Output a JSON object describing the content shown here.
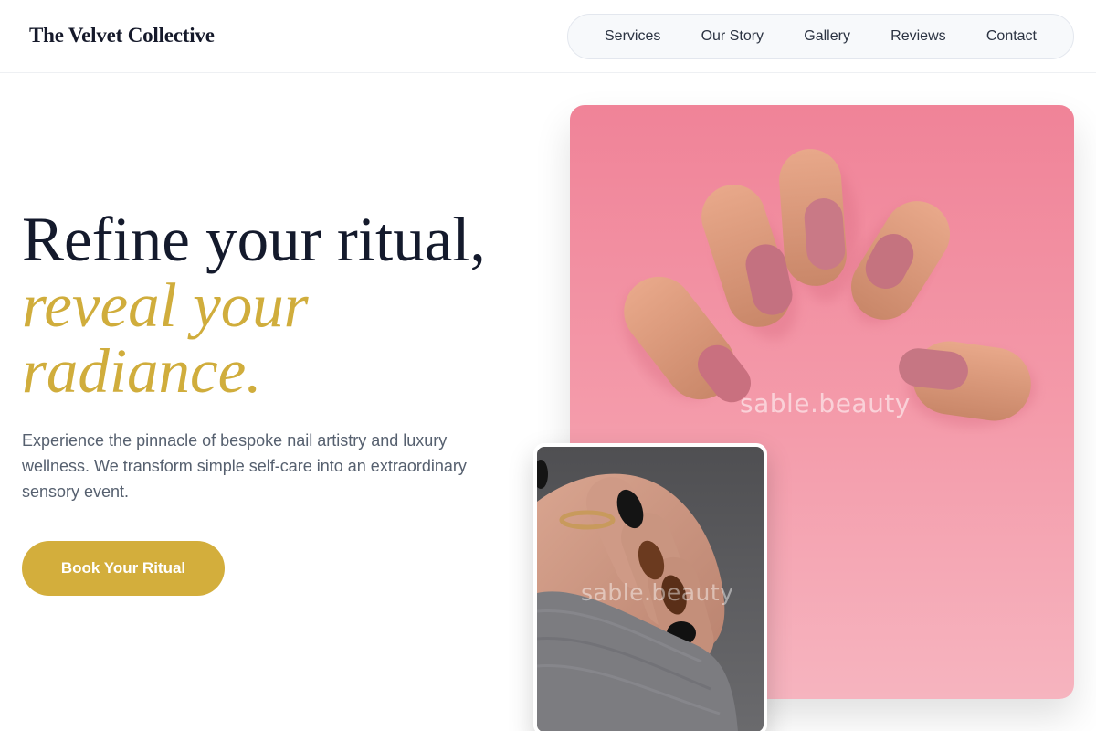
{
  "brand": {
    "name": "The Velvet Collective"
  },
  "nav": {
    "items": [
      {
        "label": "Services"
      },
      {
        "label": "Our Story"
      },
      {
        "label": "Gallery"
      },
      {
        "label": "Reviews"
      },
      {
        "label": "Contact"
      }
    ]
  },
  "hero": {
    "title_line1": "Refine your ritual,",
    "title_line2": "reveal your",
    "title_line3": "radiance.",
    "description": "Experience the pinnacle of bespoke nail artistry and luxury wellness. We transform simple self-care into an extraordinary sensory event.",
    "cta_label": "Book Your Ritual"
  },
  "images": {
    "main": {
      "watermark": "sable.beauty"
    },
    "secondary": {
      "watermark": "sable.beauty"
    }
  },
  "colors": {
    "accent_gold": "#d3ae3c",
    "heading_navy": "#141a2c",
    "body_gray": "#56606f",
    "image_pink": "#f08398"
  }
}
